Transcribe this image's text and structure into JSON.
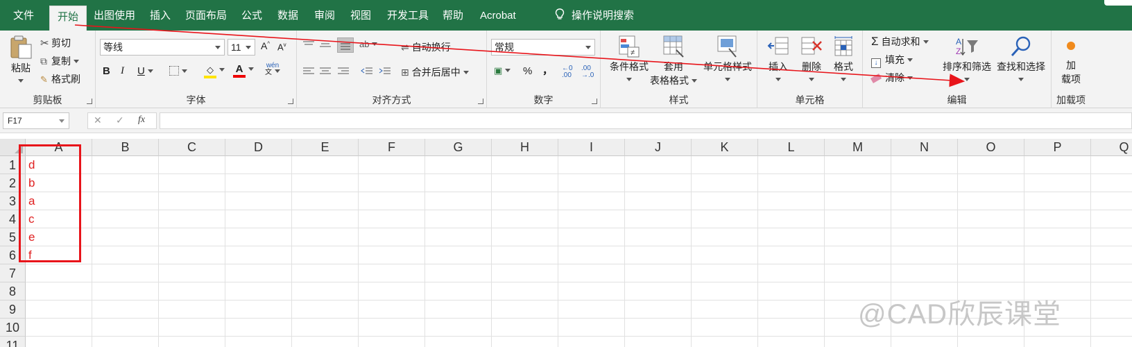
{
  "colors": {
    "brand": "#217346",
    "annotation_red": "#e8141a",
    "cell_text": "#e02020"
  },
  "menu": {
    "tabs": [
      "文件",
      "开始",
      "出图使用",
      "插入",
      "页面布局",
      "公式",
      "数据",
      "审阅",
      "视图",
      "开发工具",
      "帮助",
      "Acrobat"
    ],
    "active_tab": "开始",
    "tell_me": "操作说明搜索"
  },
  "ribbon": {
    "clipboard": {
      "paste": "粘贴",
      "cut": "剪切",
      "copy": "复制",
      "format_painter": "格式刷",
      "label": "剪贴板"
    },
    "font": {
      "name": "等线",
      "size": "11",
      "grow": "A",
      "shrink": "A",
      "bold": "B",
      "italic": "I",
      "underline": "U",
      "phonetic": "wén",
      "label": "字体"
    },
    "alignment": {
      "wrap": "自动换行",
      "merge": "合并后居中",
      "label": "对齐方式"
    },
    "number": {
      "format": "常规",
      "percent": "%",
      "comma": "，",
      "label": "数字"
    },
    "styles": {
      "conditional": "条件格式",
      "table_1": "套用",
      "table_2": "表格格式",
      "cell_styles": "单元格样式",
      "label": "样式"
    },
    "cells": {
      "insert": "插入",
      "delete": "删除",
      "format": "格式",
      "label": "单元格"
    },
    "editing": {
      "autosum": "自动求和",
      "fill": "填充",
      "clear": "清除",
      "sort": "排序和筛选",
      "find": "查找和选择",
      "label": "编辑"
    },
    "addins": {
      "line1": "加",
      "line2": "载项",
      "label": "加载项"
    }
  },
  "formula_bar": {
    "name_box": "F17",
    "cancel": "✕",
    "enter": "✓",
    "fx": "fx",
    "value": ""
  },
  "sheet": {
    "columns": [
      "A",
      "B",
      "C",
      "D",
      "E",
      "F",
      "G",
      "H",
      "I",
      "J",
      "K",
      "L",
      "M",
      "N",
      "O",
      "P",
      "Q"
    ],
    "rows": [
      "1",
      "2",
      "3",
      "4",
      "5",
      "6",
      "7",
      "8",
      "9",
      "10",
      "11"
    ],
    "column_a": [
      "d",
      "b",
      "a",
      "c",
      "e",
      "f"
    ]
  },
  "watermark": "@CAD欣辰课堂",
  "icons": [
    "paste-icon",
    "scissors-icon",
    "copy-icon",
    "format-painter-icon",
    "lightbulb-icon",
    "sort-filter-icon",
    "search-icon",
    "sigma-icon"
  ]
}
